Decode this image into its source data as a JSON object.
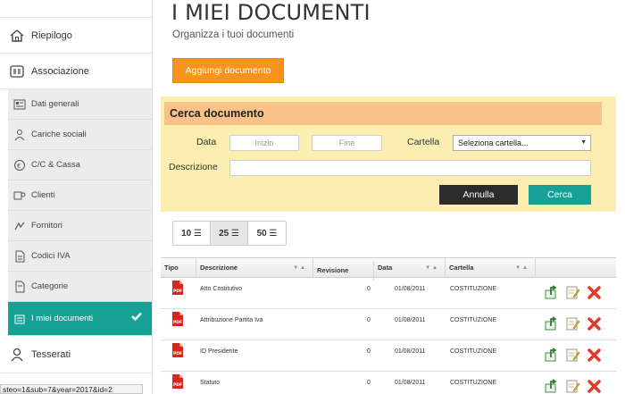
{
  "sidebar": {
    "items": [
      {
        "label": "Riepilogo",
        "icon": "home-icon"
      },
      {
        "label": "Associazione",
        "icon": "association-icon"
      }
    ],
    "subitems": [
      {
        "label": "Dati generali",
        "icon": "data-icon"
      },
      {
        "label": "Cariche sociali",
        "icon": "people-icon"
      },
      {
        "label": "C/C & Cassa",
        "icon": "bank-icon"
      },
      {
        "label": "Clienti",
        "icon": "clients-icon"
      },
      {
        "label": "Fornitori",
        "icon": "suppliers-icon"
      },
      {
        "label": "Codici IVA",
        "icon": "tax-code-icon"
      },
      {
        "label": "Categorie",
        "icon": "categories-icon"
      },
      {
        "label": "I miei documenti",
        "icon": "documents-icon",
        "active": true
      }
    ],
    "bottom_item": {
      "label": "Tesserati",
      "icon": "member-icon"
    }
  },
  "status_url": "steo=1&sub=7&year=2017&id=2",
  "page": {
    "title": "I MIEI DOCUMENTI",
    "subtitle": "Organizza i tuoi documenti",
    "add_button": "Aggiungi documento"
  },
  "search": {
    "header": "Cerca documento",
    "data_label": "Data",
    "start_placeholder": "Inizio",
    "end_placeholder": "Fine",
    "folder_label": "Cartella",
    "folder_value": "Seleziona cartella...",
    "description_label": "Descrizione",
    "description_value": "",
    "cancel_button": "Annulla",
    "search_button": "Cerca"
  },
  "pager": {
    "options": [
      "10",
      "25",
      "50"
    ],
    "active": "25"
  },
  "table": {
    "columns": [
      "Tipo",
      "Descrizione",
      "Revisione",
      "Data",
      "Cartella"
    ],
    "rows": [
      {
        "type": "PDF",
        "description": "Atto Costitutivo",
        "revision": "0",
        "date": "01/08/2011",
        "folder": "COSTITUZIONE"
      },
      {
        "type": "PDF",
        "description": "Attribuzione Partita Iva",
        "revision": "0",
        "date": "01/08/2011",
        "folder": "COSTITUZIONE"
      },
      {
        "type": "PDF",
        "description": "ID Presidente",
        "revision": "0",
        "date": "01/08/2011",
        "folder": "COSTITUZIONE"
      },
      {
        "type": "PDF",
        "description": "Statuto",
        "revision": "0",
        "date": "01/08/2011",
        "folder": "COSTITUZIONE"
      }
    ]
  },
  "colors": {
    "accent": "#16a197",
    "orange": "#f7941d",
    "panel": "#fbeeb0",
    "panel_header": "#f9c387"
  }
}
